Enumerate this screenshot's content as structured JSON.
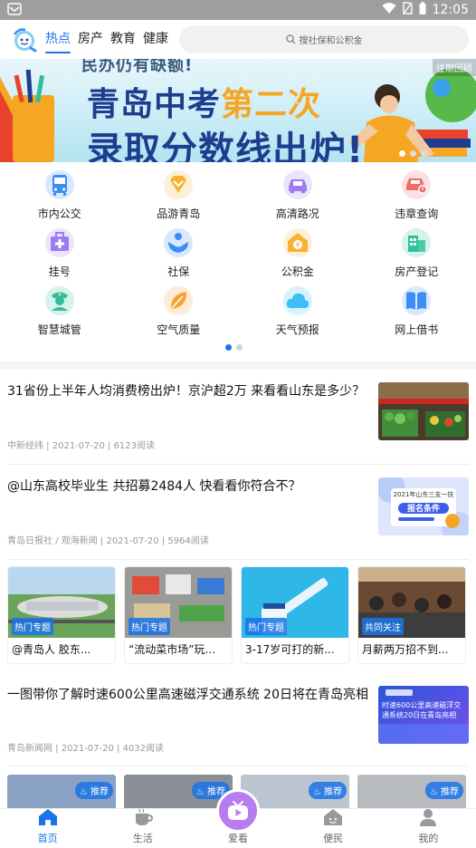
{
  "status_bar": {
    "time": "12:05"
  },
  "top_nav": {
    "tabs": [
      {
        "label": "热点",
        "active": true
      },
      {
        "label": "房产",
        "active": false
      },
      {
        "label": "教育",
        "active": false
      },
      {
        "label": "健康",
        "active": false
      }
    ],
    "search_placeholder": "搜社保和公积金"
  },
  "banner": {
    "top_text": "民办仍有缺额!",
    "line1_pre": "青岛中考",
    "line1_highlight": "第二次",
    "line2": "录取分数线出炉!",
    "corner_tag": "往期回顾",
    "carousel_index": 0,
    "carousel_count": 3
  },
  "services": [
    {
      "label": "市内公交",
      "icon": "bus-icon",
      "color": "#3d8df5"
    },
    {
      "label": "品游青岛",
      "icon": "diamond-icon",
      "color": "#f7b233"
    },
    {
      "label": "高清路况",
      "icon": "car-icon",
      "color": "#9c7cf0"
    },
    {
      "label": "违章查询",
      "icon": "violation-car-icon",
      "color": "#f26a6a"
    },
    {
      "label": "挂号",
      "icon": "medical-bag-icon",
      "color": "#9c7cf0"
    },
    {
      "label": "社保",
      "icon": "hands-icon",
      "color": "#3d8df5"
    },
    {
      "label": "公积金",
      "icon": "house-coin-icon",
      "color": "#f7b233"
    },
    {
      "label": "房产登记",
      "icon": "buildings-icon",
      "color": "#2fbf9a"
    },
    {
      "label": "智慧城管",
      "icon": "officer-icon",
      "color": "#2fbf9a"
    },
    {
      "label": "空气质量",
      "icon": "leaf-icon",
      "color": "#f7a233"
    },
    {
      "label": "天气预报",
      "icon": "cloud-icon",
      "color": "#3dbef5"
    },
    {
      "label": "网上借书",
      "icon": "book-icon",
      "color": "#3d8df5"
    }
  ],
  "services_page": {
    "current": 0,
    "total": 2
  },
  "news": [
    {
      "title": "31省份上半年人均消费榜出炉！京沪超2万 来看看山东是多少？",
      "meta": "中新经纬 | 2021-07-20 | 6123阅读",
      "thumb": "market-photo"
    },
    {
      "title": "@山东高校毕业生 共招募2484人 快看看你符合不？",
      "meta": "青岛日报社 / 观海新闻 | 2021-07-20 | 5964阅读",
      "thumb": "recruit-poster",
      "thumb_text_1": "2021年山东三支一扶",
      "thumb_text_2": "报名条件"
    }
  ],
  "topic_cards": [
    {
      "tag": "热门专题",
      "caption": "@青岛人 胶东...",
      "thumb": "airport-photo"
    },
    {
      "tag": "热门专题",
      "caption": "“流动菜市场”玩...",
      "thumb": "market-aerial-photo"
    },
    {
      "tag": "热门专题",
      "caption": "3-17岁可打的新...",
      "thumb": "vaccine-photo"
    },
    {
      "tag": "共同关注",
      "caption": "月薪两万招不到...",
      "thumb": "job-fair-photo"
    }
  ],
  "news2": {
    "title": "一图带你了解时速600公里高速磁浮交通系统 20日将在青岛亮相",
    "meta": "青岛新闻网 | 2021-07-20 | 4032阅读",
    "thumb": "maglev-poster",
    "thumb_text": "时速600公里高速磁浮交通系统20日在青岛亮相"
  },
  "video_tags": [
    "推荐",
    "推荐",
    "推荐",
    "推荐"
  ],
  "bottom_nav": [
    {
      "label": "首页",
      "icon": "home-icon",
      "active": true
    },
    {
      "label": "生活",
      "icon": "cup-icon",
      "active": false
    },
    {
      "label": "爱看",
      "icon": "tv-icon",
      "active": false
    },
    {
      "label": "便民",
      "icon": "smile-house-icon",
      "active": false
    },
    {
      "label": "我的",
      "icon": "person-icon",
      "active": false
    }
  ]
}
